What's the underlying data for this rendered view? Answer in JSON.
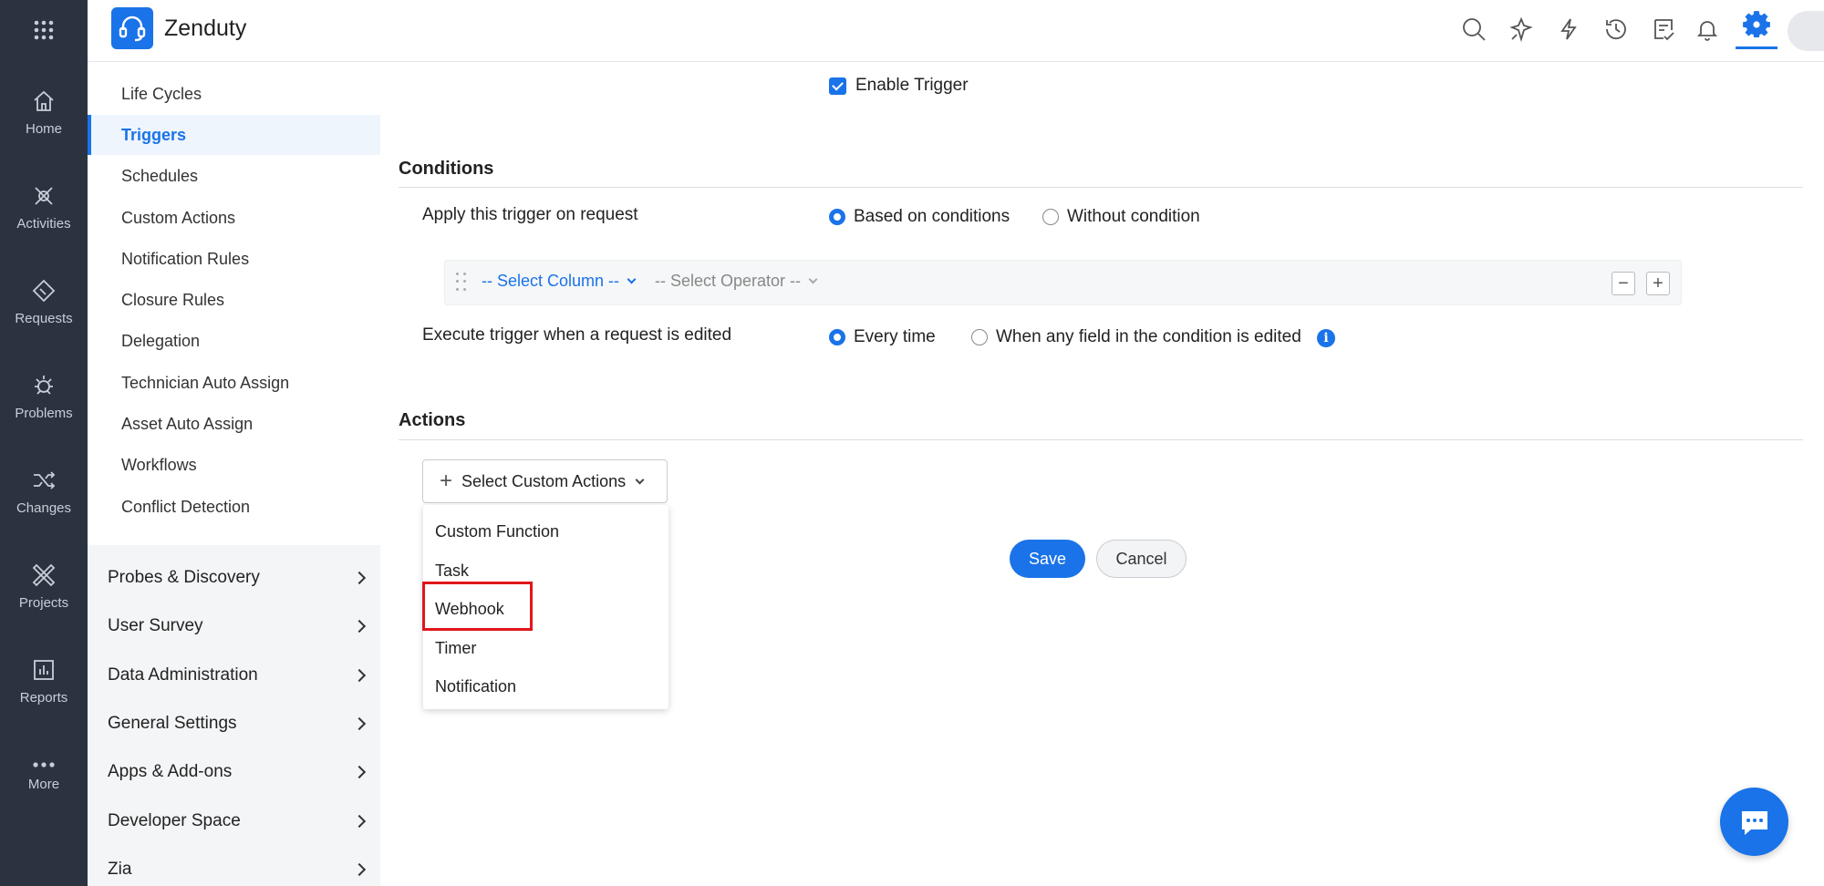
{
  "app": {
    "brand_name": "Zenduty",
    "accent_color": "#1a73e8"
  },
  "rail": {
    "items": [
      {
        "label": "Home",
        "icon": "home-icon"
      },
      {
        "label": "Activities",
        "icon": "activities-icon"
      },
      {
        "label": "Requests",
        "icon": "requests-icon"
      },
      {
        "label": "Problems",
        "icon": "problems-icon"
      },
      {
        "label": "Changes",
        "icon": "changes-icon"
      },
      {
        "label": "Projects",
        "icon": "projects-icon"
      },
      {
        "label": "Reports",
        "icon": "reports-icon"
      },
      {
        "label": "More",
        "icon": "more-icon"
      }
    ]
  },
  "header": {
    "icons": [
      "search-icon",
      "magic-wand-icon",
      "lightning-icon",
      "history-icon",
      "notes-icon",
      "bell-icon",
      "gear-icon"
    ]
  },
  "sidebar": {
    "sub_items": [
      "Life Cycles",
      "Triggers",
      "Schedules",
      "Custom Actions",
      "Notification Rules",
      "Closure Rules",
      "Delegation",
      "Technician Auto Assign",
      "Asset Auto Assign",
      "Workflows",
      "Conflict Detection"
    ],
    "active": "Triggers",
    "groups": [
      "Probes & Discovery",
      "User Survey",
      "Data Administration",
      "General Settings",
      "Apps & Add-ons",
      "Developer Space",
      "Zia"
    ]
  },
  "main": {
    "enable_trigger_label": "Enable Trigger",
    "conditions": {
      "title": "Conditions",
      "apply_label": "Apply this trigger on request",
      "apply_options": [
        "Based on conditions",
        "Without condition"
      ],
      "apply_selected": "Based on conditions",
      "select_column": "-- Select Column --",
      "select_operator": "-- Select Operator --",
      "minus": "−",
      "plus": "+",
      "execute_label": "Execute trigger when a request is edited",
      "execute_options": [
        "Every time",
        "When any field in the condition is edited"
      ],
      "execute_selected": "Every time",
      "info": "i"
    },
    "actions": {
      "title": "Actions",
      "select_label": "Select Custom Actions",
      "dropdown_items": [
        "Custom Function",
        "Task",
        "Webhook",
        "Timer",
        "Notification"
      ],
      "highlighted_item": "Webhook"
    },
    "save_label": "Save",
    "cancel_label": "Cancel"
  }
}
